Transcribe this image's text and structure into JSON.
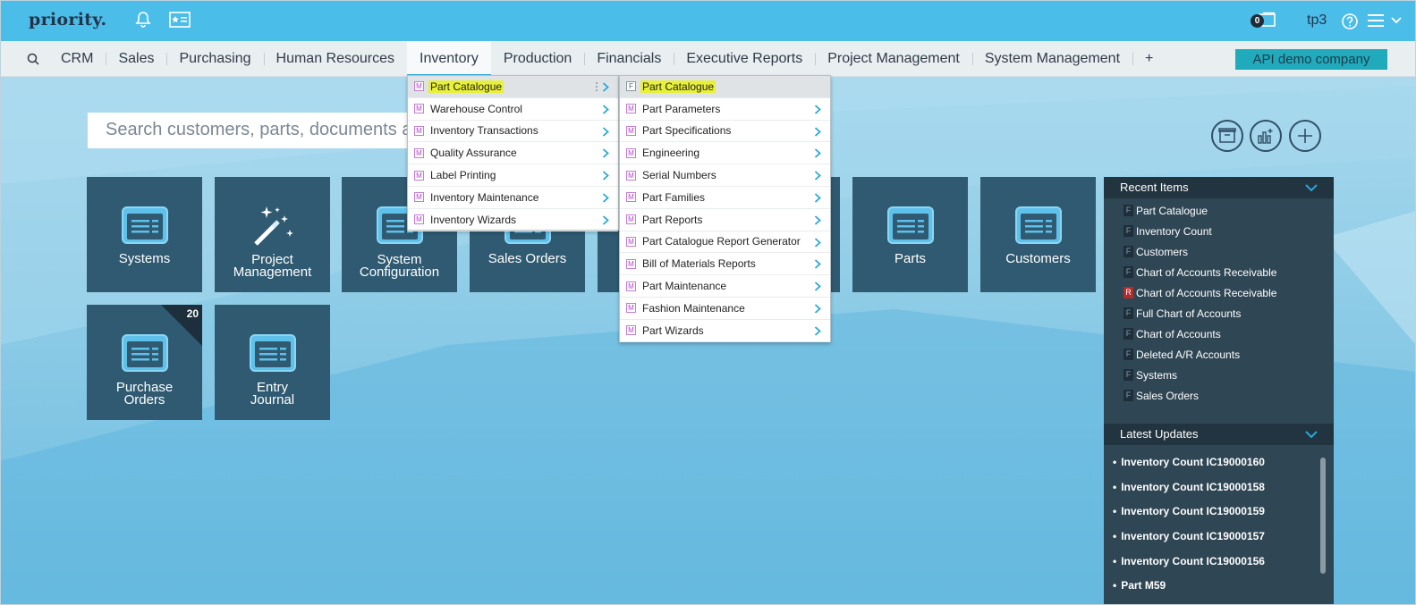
{
  "topbar": {
    "logo": "priority.",
    "counter_badge": "0",
    "user": "tp3"
  },
  "nav": {
    "items": [
      "CRM",
      "Sales",
      "Purchasing",
      "Human Resources",
      "Inventory",
      "Production",
      "Financials",
      "Executive Reports",
      "Project Management",
      "System Management",
      "+"
    ],
    "active": "Inventory",
    "company": "API demo company"
  },
  "search": {
    "placeholder": "Search customers, parts, documents a"
  },
  "tiles": {
    "row1": [
      {
        "label": "Systems",
        "icon": "list-card-icon"
      },
      {
        "label": "Project Management",
        "icon": "magic-wand-icon"
      },
      {
        "label": "System Configuration",
        "icon": "list-card-icon"
      },
      {
        "label": "Sales Orders",
        "icon": "list-card-icon"
      },
      {
        "label": "",
        "icon": "list-card-icon"
      },
      {
        "label": "",
        "icon": "list-card-icon"
      },
      {
        "label": "Parts",
        "icon": "list-card-icon"
      },
      {
        "label": "Customers",
        "icon": "list-card-icon"
      }
    ],
    "row2": [
      {
        "label": "Purchase Orders",
        "icon": "list-card-icon",
        "count": "20"
      },
      {
        "label": "Entry Journal",
        "icon": "list-card-icon"
      }
    ]
  },
  "menu1": {
    "items": [
      {
        "label": "Part Catalogue",
        "badge": "M",
        "selected": true
      },
      {
        "label": "Warehouse Control",
        "badge": "M"
      },
      {
        "label": "Inventory Transactions",
        "badge": "M"
      },
      {
        "label": "Quality Assurance",
        "badge": "M"
      },
      {
        "label": "Label Printing",
        "badge": "M"
      },
      {
        "label": "Inventory Maintenance",
        "badge": "M"
      },
      {
        "label": "Inventory Wizards",
        "badge": "M"
      }
    ]
  },
  "menu2": {
    "items": [
      {
        "label": "Part Catalogue",
        "badge": "F",
        "selected": true
      },
      {
        "label": "Part Parameters",
        "badge": "M"
      },
      {
        "label": "Part Specifications",
        "badge": "M"
      },
      {
        "label": "Engineering",
        "badge": "M"
      },
      {
        "label": "Serial Numbers",
        "badge": "M"
      },
      {
        "label": "Part Families",
        "badge": "M"
      },
      {
        "label": "Part Reports",
        "badge": "M"
      },
      {
        "label": "Part Catalogue Report Generator",
        "badge": "M"
      },
      {
        "label": "Bill of Materials Reports",
        "badge": "M"
      },
      {
        "label": "Part Maintenance",
        "badge": "M"
      },
      {
        "label": "Fashion Maintenance",
        "badge": "M"
      },
      {
        "label": "Part Wizards",
        "badge": "M"
      }
    ]
  },
  "recent": {
    "title": "Recent Items",
    "items": [
      {
        "label": "Part Catalogue",
        "badge": "F"
      },
      {
        "label": "Inventory Count",
        "badge": "F"
      },
      {
        "label": "Customers",
        "badge": "F"
      },
      {
        "label": "Chart of Accounts Receivable",
        "badge": "F"
      },
      {
        "label": "Chart of Accounts Receivable",
        "badge": "R"
      },
      {
        "label": "Full Chart of Accounts",
        "badge": "F"
      },
      {
        "label": "Chart of Accounts",
        "badge": "F"
      },
      {
        "label": "Deleted A/R Accounts",
        "badge": "F"
      },
      {
        "label": "Systems",
        "badge": "F"
      },
      {
        "label": "Sales Orders",
        "badge": "F"
      }
    ]
  },
  "latest": {
    "title": "Latest Updates",
    "items": [
      "Inventory Count IC19000160",
      "Inventory Count IC19000158",
      "Inventory Count IC19000159",
      "Inventory Count IC19000157",
      "Inventory Count IC19000156",
      "Part M59"
    ]
  },
  "colors": {
    "topbar": "#4bbde9",
    "tile": "#2f5a71",
    "panel": "#2f4654",
    "accent": "#21aabb",
    "highlight": "#e8f03a"
  }
}
